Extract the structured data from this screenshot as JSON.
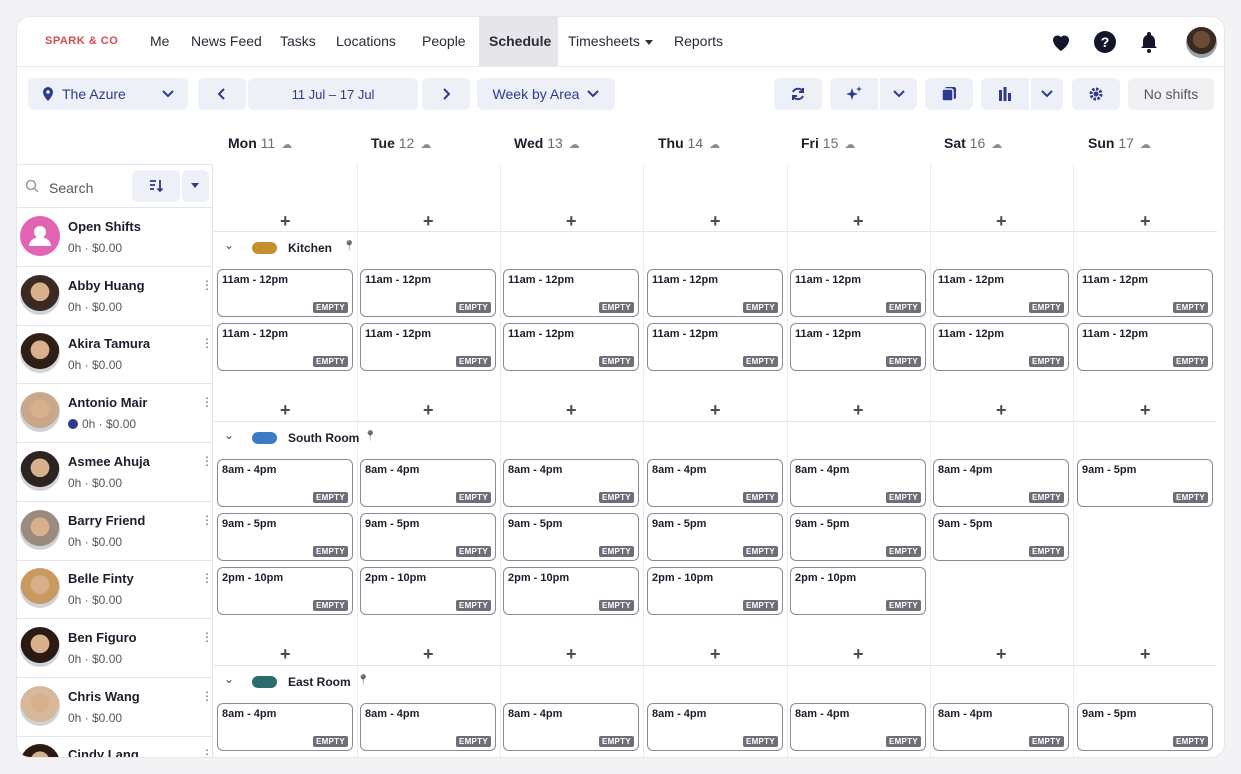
{
  "brand": "SPARK & CO",
  "nav": [
    "Me",
    "News Feed",
    "Tasks",
    "Locations",
    "People",
    "Schedule",
    "Timesheets",
    "Reports"
  ],
  "nav_active": "Schedule",
  "toolbar": {
    "location": "The Azure",
    "date_range": "11 Jul – 17 Jul",
    "view": "Week by Area",
    "no_shifts": "No shifts"
  },
  "days": [
    {
      "name": "Mon",
      "num": "11"
    },
    {
      "name": "Tue",
      "num": "12"
    },
    {
      "name": "Wed",
      "num": "13"
    },
    {
      "name": "Thu",
      "num": "14"
    },
    {
      "name": "Fri",
      "num": "15"
    },
    {
      "name": "Sat",
      "num": "16"
    },
    {
      "name": "Sun",
      "num": "17"
    }
  ],
  "search": {
    "placeholder": "Search"
  },
  "people": [
    {
      "name": "Open Shifts",
      "sub": "0h · $0.00"
    },
    {
      "name": "Abby Huang",
      "sub": "0h · $0.00"
    },
    {
      "name": "Akira Tamura",
      "sub": "0h · $0.00"
    },
    {
      "name": "Antonio Mair",
      "sub": "0h · $0.00"
    },
    {
      "name": "Asmee Ahuja",
      "sub": "0h · $0.00"
    },
    {
      "name": "Barry Friend",
      "sub": "0h · $0.00"
    },
    {
      "name": "Belle Finty",
      "sub": "0h · $0.00"
    },
    {
      "name": "Ben Figuro",
      "sub": "0h · $0.00"
    },
    {
      "name": "Chris Wang",
      "sub": "0h · $0.00"
    },
    {
      "name": "Cindy Lang",
      "sub": ""
    }
  ],
  "empty_label": "EMPTY",
  "areas": [
    {
      "name": "Kitchen",
      "color": "#c4902f",
      "shifts": [
        [
          "11am - 12pm",
          "11am - 12pm",
          "11am - 12pm",
          "11am - 12pm",
          "11am - 12pm",
          "11am - 12pm",
          "11am - 12pm"
        ],
        [
          "11am - 12pm",
          "11am - 12pm",
          "11am - 12pm",
          "11am - 12pm",
          "11am - 12pm",
          "11am - 12pm",
          "11am - 12pm"
        ]
      ]
    },
    {
      "name": "South Room",
      "color": "#3b7bc4",
      "shifts": [
        [
          "8am - 4pm",
          "8am - 4pm",
          "8am - 4pm",
          "8am - 4pm",
          "8am - 4pm",
          "8am - 4pm",
          "9am - 5pm"
        ],
        [
          "9am - 5pm",
          "9am - 5pm",
          "9am - 5pm",
          "9am - 5pm",
          "9am - 5pm",
          "9am - 5pm",
          ""
        ],
        [
          "2pm - 10pm",
          "2pm - 10pm",
          "2pm - 10pm",
          "2pm - 10pm",
          "2pm - 10pm",
          "",
          ""
        ]
      ]
    },
    {
      "name": "East Room",
      "color": "#2a6b6b",
      "shifts": [
        [
          "8am - 4pm",
          "8am - 4pm",
          "8am - 4pm",
          "8am - 4pm",
          "8am - 4pm",
          "8am - 4pm",
          "9am - 5pm"
        ]
      ]
    }
  ]
}
